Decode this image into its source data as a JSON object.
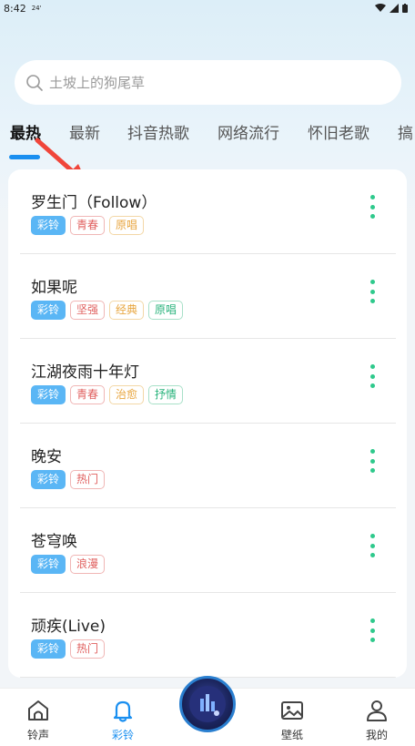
{
  "status_bar": {
    "time": "8:42",
    "extra": "24'"
  },
  "search": {
    "placeholder": "土坡上的狗尾草"
  },
  "tabs": [
    {
      "label": "最热",
      "active": true
    },
    {
      "label": "最新"
    },
    {
      "label": "抖音热歌"
    },
    {
      "label": "网络流行"
    },
    {
      "label": "怀旧老歌"
    },
    {
      "label": "搞"
    }
  ],
  "songs": [
    {
      "title": "罗生门（Follow）",
      "tags": [
        "彩铃",
        "青春",
        "原唱"
      ]
    },
    {
      "title": "如果呢",
      "tags": [
        "彩铃",
        "坚强",
        "经典",
        "原唱"
      ]
    },
    {
      "title": "江湖夜雨十年灯",
      "tags": [
        "彩铃",
        "青春",
        "治愈",
        "抒情"
      ]
    },
    {
      "title": "晚安",
      "tags": [
        "彩铃",
        "热门"
      ]
    },
    {
      "title": "苍穹唤",
      "tags": [
        "彩铃",
        "浪漫"
      ]
    },
    {
      "title": "顽疾(Live)",
      "tags": [
        "彩铃",
        "热门"
      ]
    }
  ],
  "bottom_nav": [
    {
      "label": "铃声",
      "icon": "bell-house-icon"
    },
    {
      "label": "彩铃",
      "icon": "bell-icon",
      "active": true
    },
    {
      "label": "壁纸",
      "icon": "image-icon"
    },
    {
      "label": "我的",
      "icon": "user-icon"
    }
  ],
  "colors": {
    "accent": "#1a8ff0",
    "ring_tag": "#5ab6f5",
    "more_dots": "#2fc98c",
    "arrow": "#f0453a"
  }
}
